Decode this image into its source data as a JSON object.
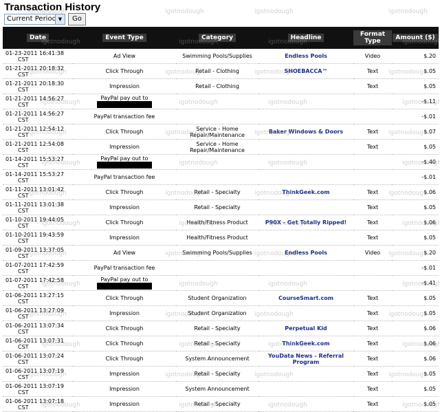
{
  "page": {
    "title": "Transaction History",
    "period_select": "Current Period",
    "go_label": "Go",
    "watermark": "igotnodough"
  },
  "table": {
    "headers": [
      "Date",
      "Event Type",
      "Category",
      "Headline",
      "Format Type",
      "Amount ($)"
    ],
    "rows": [
      {
        "date": "01-23-2011 16:41:38",
        "tz": "CST",
        "event": "Ad View",
        "category": "Swimming Pools/Supplies",
        "headline": "Endless Pools",
        "format": "Video",
        "amount": "$.20"
      },
      {
        "date": "01-21-2011 20:18:32",
        "tz": "CST",
        "event": "Click Through",
        "category": "Retail - Clothing",
        "headline": "SHOEBACCA™",
        "format": "Text",
        "amount": "$.05"
      },
      {
        "date": "01-21-2011 20:18:30",
        "tz": "CST",
        "event": "Impression",
        "category": "Retail - Clothing",
        "headline": "",
        "format": "Text",
        "amount": "$.05"
      },
      {
        "date": "01-21-2011 14:56:27",
        "tz": "CST",
        "event": "PayPal pay out to",
        "redacted": true,
        "category": "",
        "headline": "",
        "format": "",
        "amount": "-$.11"
      },
      {
        "date": "01-21-2011 14:56:27",
        "tz": "CST",
        "event": "PayPal transaction fee",
        "category": "",
        "headline": "",
        "format": "",
        "amount": "-$.01"
      },
      {
        "date": "01-21-2011 12:54:12",
        "tz": "CST",
        "event": "Click Through",
        "category": "Service - Home Repair/Maintenance",
        "headline": "Baker Windows & Doors",
        "format": "Text",
        "amount": "$.07"
      },
      {
        "date": "01-21-2011 12:54:08",
        "tz": "CST",
        "event": "Impression",
        "category": "Service - Home Repair/Maintenance",
        "headline": "",
        "format": "Text",
        "amount": "$.05"
      },
      {
        "date": "01-14-2011 15:53:27",
        "tz": "CST",
        "event": "PayPal pay out to",
        "redacted": true,
        "category": "",
        "headline": "",
        "format": "",
        "amount": "-$.40"
      },
      {
        "date": "01-14-2011 15:53:27",
        "tz": "CST",
        "event": "PayPal transaction fee",
        "category": "",
        "headline": "",
        "format": "",
        "amount": "-$.01"
      },
      {
        "date": "01-11-2011 13:01:42",
        "tz": "CST",
        "event": "Click Through",
        "category": "Retail - Specialty",
        "headline": "ThinkGeek.com",
        "format": "Text",
        "amount": "$.06"
      },
      {
        "date": "01-11-2011 13:01:38",
        "tz": "CST",
        "event": "Impression",
        "category": "Retail - Specialty",
        "headline": "",
        "format": "Text",
        "amount": "$.05"
      },
      {
        "date": "01-10-2011 19:44:05",
        "tz": "CST",
        "event": "Click Through",
        "category": "Health/Fitness Product",
        "headline": "P90X - Get Totally Ripped!",
        "format": "Text",
        "amount": "$.06"
      },
      {
        "date": "01-10-2011 19:43:59",
        "tz": "CST",
        "event": "Impression",
        "category": "Health/Fitness Product",
        "headline": "",
        "format": "Text",
        "amount": "$.05"
      },
      {
        "date": "01-09-2011 13:37:05",
        "tz": "CST",
        "event": "Ad View",
        "category": "Swimming Pools/Supplies",
        "headline": "Endless Pools",
        "format": "Video",
        "amount": "$.20"
      },
      {
        "date": "01-07-2011 17:42:59",
        "tz": "CST",
        "event": "PayPal transaction fee",
        "category": "",
        "headline": "",
        "format": "",
        "amount": "-$.01"
      },
      {
        "date": "01-07-2011 17:42:58",
        "tz": "CST",
        "event": "PayPal pay out to",
        "redacted": true,
        "category": "",
        "headline": "",
        "format": "",
        "amount": "-$.41"
      },
      {
        "date": "01-06-2011 13:27:15",
        "tz": "CST",
        "event": "Click Through",
        "category": "Student Organization",
        "headline": "CourseSmart.com",
        "format": "Text",
        "amount": "$.05"
      },
      {
        "date": "01-06-2011 13:27:09",
        "tz": "CST",
        "event": "Impression",
        "category": "Student Organization",
        "headline": "",
        "format": "Text",
        "amount": "$.05"
      },
      {
        "date": "01-06-2011 13:07:34",
        "tz": "CST",
        "event": "Click Through",
        "category": "Retail - Specialty",
        "headline": "Perpetual Kid",
        "format": "Text",
        "amount": "$.06"
      },
      {
        "date": "01-06-2011 13:07:31",
        "tz": "CST",
        "event": "Click Through",
        "category": "Retail - Specialty",
        "headline": "ThinkGeek.com",
        "format": "Text",
        "amount": "$.06"
      },
      {
        "date": "01-06-2011 13:07:24",
        "tz": "CST",
        "event": "Click Through",
        "category": "System Announcement",
        "headline": "YouData News - Referral Program",
        "format": "Text",
        "amount": "$.06"
      },
      {
        "date": "01-06-2011 13:07:19",
        "tz": "CST",
        "event": "Impression",
        "category": "Retail - Specialty",
        "headline": "",
        "format": "Text",
        "amount": "$.05"
      },
      {
        "date": "01-06-2011 13:07:19",
        "tz": "CST",
        "event": "Impression",
        "category": "System Announcement",
        "headline": "",
        "format": "Text",
        "amount": "$.05"
      },
      {
        "date": "01-06-2011 13:07:18",
        "tz": "CST",
        "event": "Impression",
        "category": "Retail - Specialty",
        "headline": "",
        "format": "Text",
        "amount": "$.05"
      }
    ]
  }
}
